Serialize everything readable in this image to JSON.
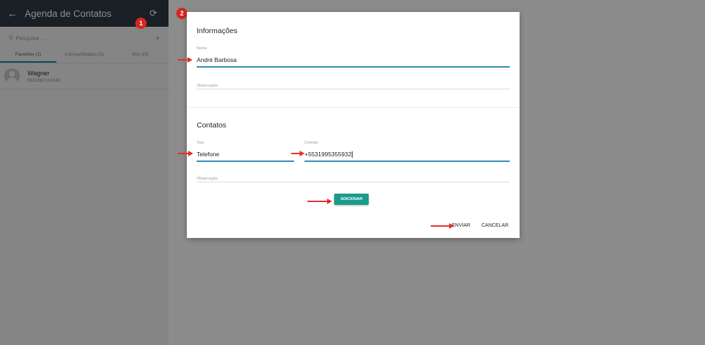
{
  "sidebar": {
    "title": "Agenda de Contatos",
    "back_icon": "←",
    "refresh_icon": "⟳",
    "search_placeholder": "Pesquisa ...",
    "add_icon": "+",
    "tabs": [
      "Favoritos (1)",
      "Compartilhados (5)",
      "Bot (19)"
    ],
    "contacts": [
      {
        "name": "Wagner",
        "phone": "5531987110243"
      }
    ]
  },
  "badges": {
    "first": "1",
    "second": "2"
  },
  "modal": {
    "info_title": "Informações",
    "name_label": "Nome",
    "name_value": "André Barbosa",
    "obs_label": "Observação",
    "contacts_title": "Contatos",
    "type_label": "Tipo",
    "type_value": "Telefone",
    "contact_label": "Contato",
    "contact_value": "+5531995355932",
    "contact_obs_label": "Observação",
    "add_button": "ADICIONAR",
    "send_button": "ENVIAR",
    "cancel_button": "CANCELAR"
  },
  "colors": {
    "topbar": "#2e3a42",
    "accent": "#177fa4",
    "add_button": "#1a9b8c",
    "annotation": "#d6261f",
    "overlay": "#8c8c8c"
  }
}
